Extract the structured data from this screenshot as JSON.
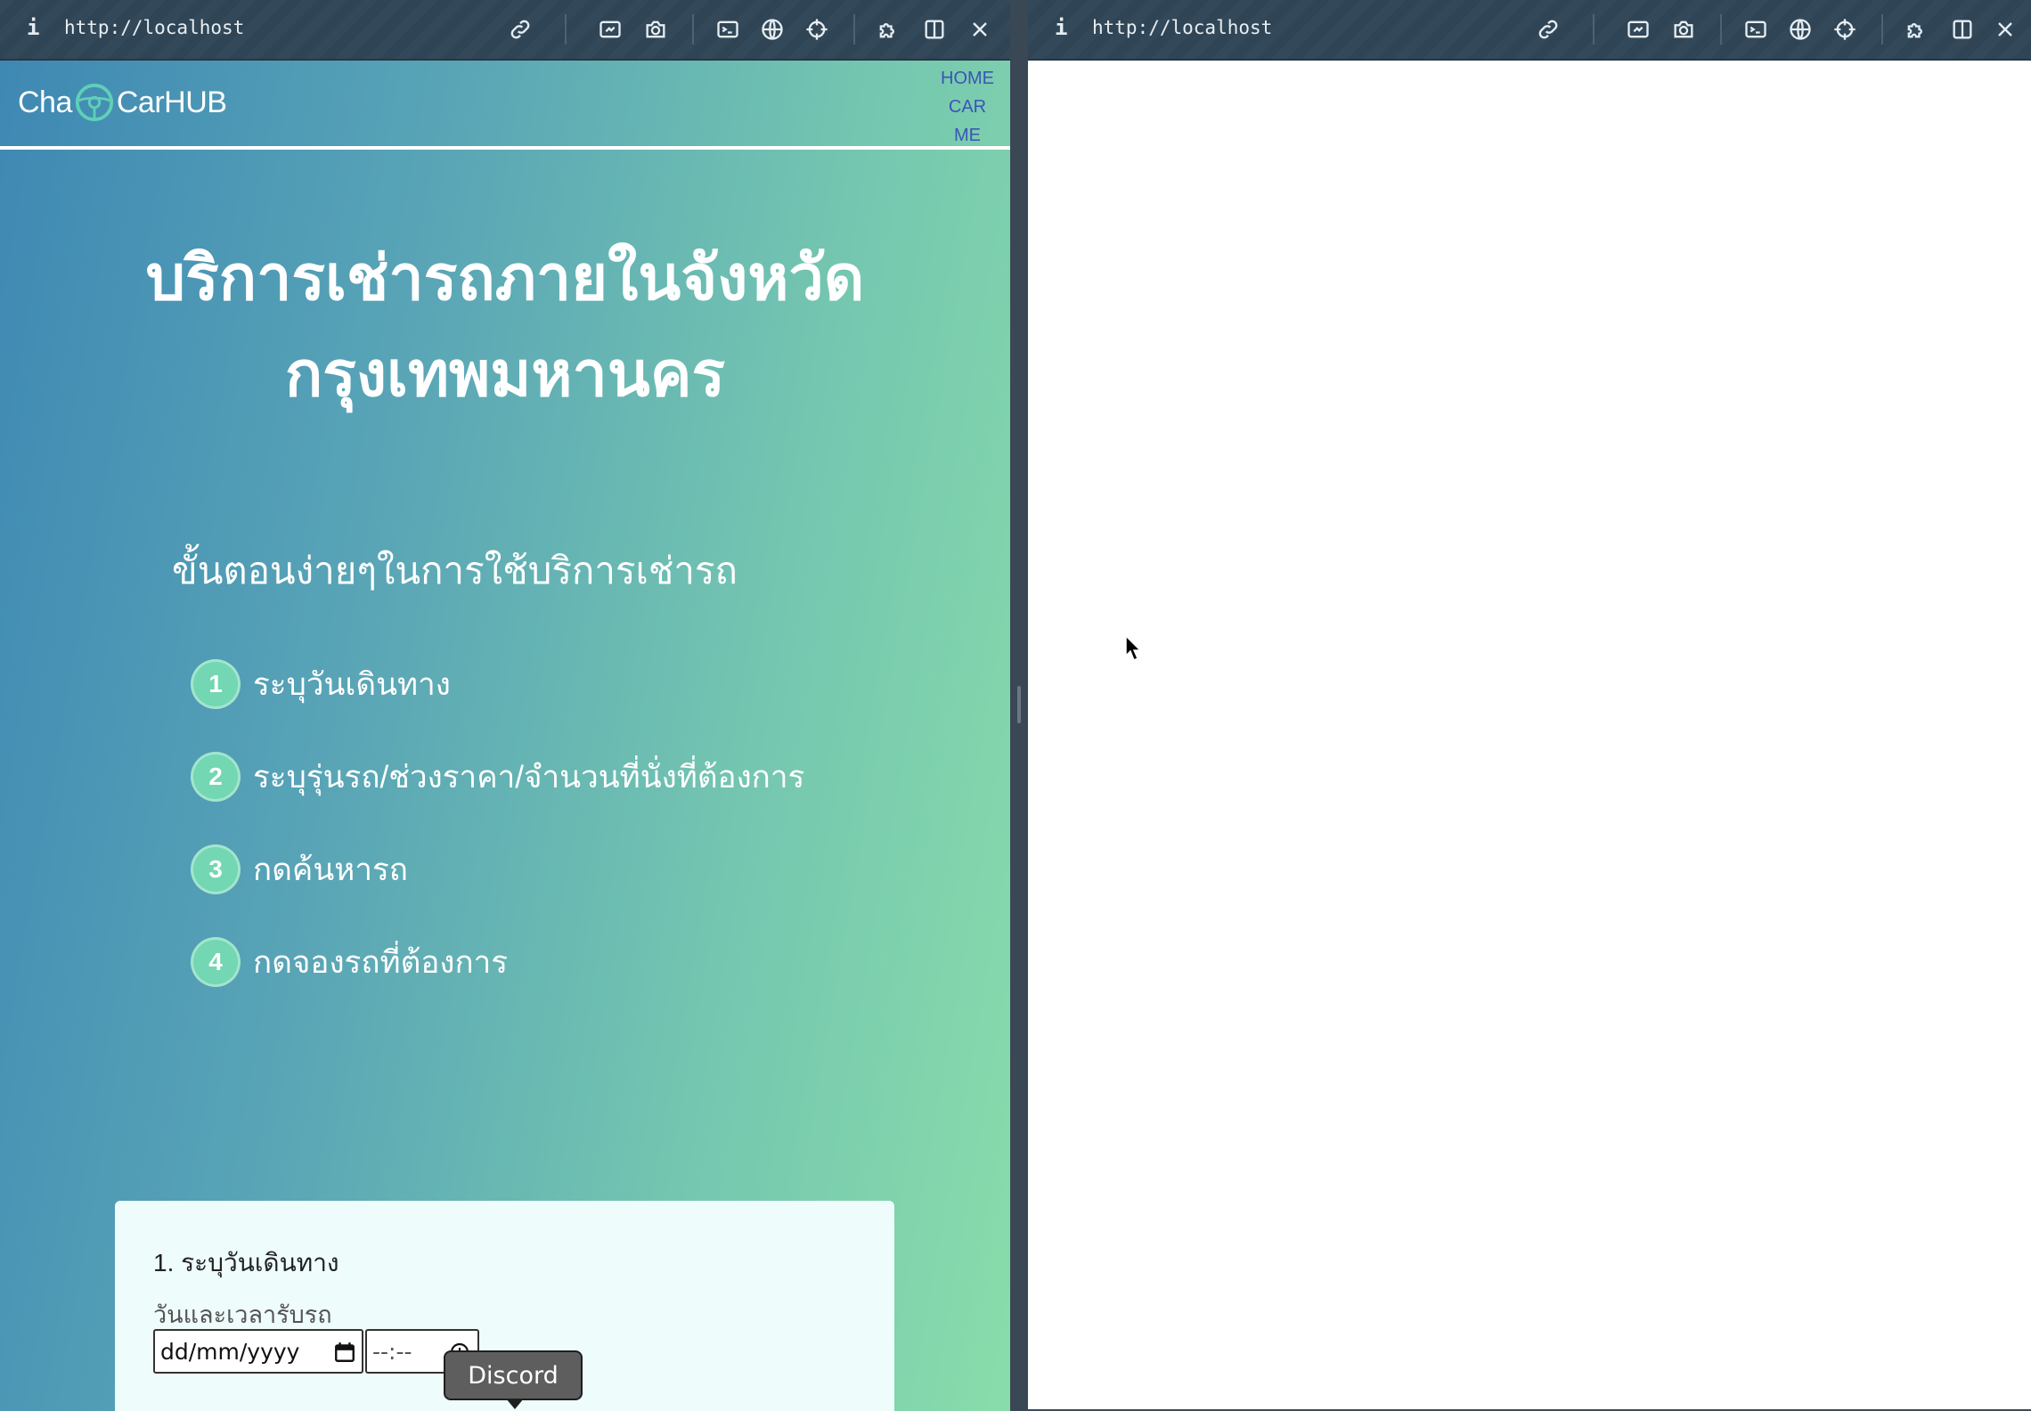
{
  "left_pane": {
    "toolbar": {
      "info_icon": "i",
      "url": "http://localhost",
      "icons": [
        "link-icon",
        "screenshot-icon",
        "camera-icon",
        "terminal-icon",
        "globe-icon",
        "crosshair-icon",
        "extension-icon",
        "split-view-icon",
        "close-icon"
      ]
    },
    "app": {
      "logo_prefix": "Cha",
      "logo_suffix": "CarHUB",
      "nav": [
        "HOME",
        "CAR",
        "ME"
      ],
      "hero_line1": "บริการเช่ารถภายในจังหวัด",
      "hero_line2": "กรุงเทพมหานคร",
      "steps_title": "ขั้นตอนง่ายๆในการใช้บริการเช่ารถ",
      "steps": [
        {
          "num": "1",
          "text": "ระบุวันเดินทาง"
        },
        {
          "num": "2",
          "text": "ระบุรุ่นรถ/ช่วงราคา/จำนวนที่นั่งที่ต้องการ"
        },
        {
          "num": "3",
          "text": "กดค้นหารถ"
        },
        {
          "num": "4",
          "text": "กดจองรถที่ต้องการ"
        }
      ],
      "form": {
        "step_heading": "1. ระบุวันเดินทาง",
        "pickup_label": "วันและเวลารับรถ",
        "date_placeholder": "dd/mm/yyyy",
        "time_placeholder": "--:--"
      }
    },
    "tooltip": "Discord"
  },
  "right_pane": {
    "toolbar": {
      "info_icon": "i",
      "url": "http://localhost"
    }
  },
  "colors": {
    "gradient_start": "#3e88b4",
    "gradient_end": "#89dcaa",
    "step_badge": "#72d7b2",
    "nav_link": "#3a55b6",
    "toolbar": "#33495a"
  }
}
